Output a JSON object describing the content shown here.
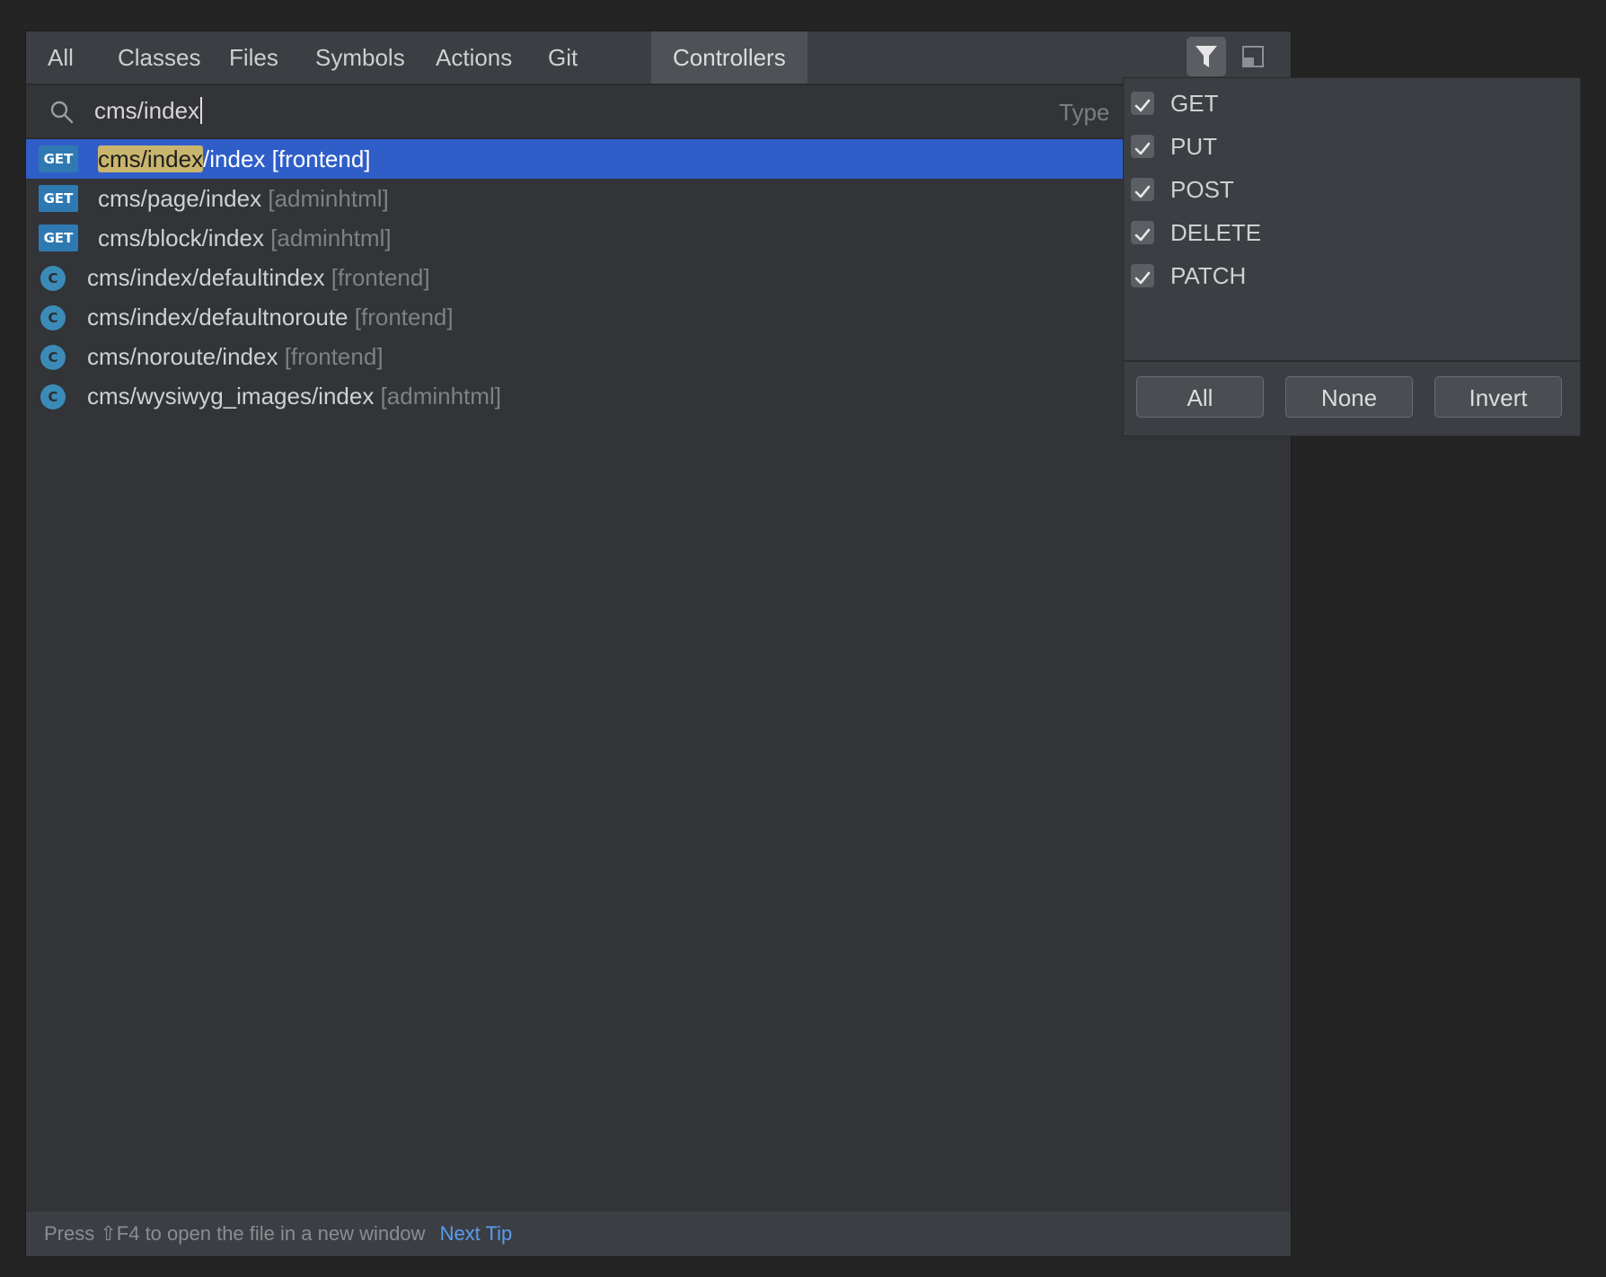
{
  "tabs": [
    {
      "label": "All",
      "active": false
    },
    {
      "label": "Classes",
      "active": false
    },
    {
      "label": "Files",
      "active": false
    },
    {
      "label": "Symbols",
      "active": false
    },
    {
      "label": "Actions",
      "active": false
    },
    {
      "label": "Git",
      "active": false
    },
    {
      "label": "Controllers",
      "active": true
    }
  ],
  "toolbar": {
    "filter_icon": "filter-icon",
    "preview_icon": "preview-panel-icon",
    "filter_active": true
  },
  "search": {
    "value": "cms/index",
    "hint": "Type "
  },
  "results": [
    {
      "kind": "GET",
      "match": "cms/index",
      "rest": "/index",
      "context": "[frontend]",
      "selected": true
    },
    {
      "kind": "GET",
      "match": "",
      "rest": "cms/page/index",
      "context": "[adminhtml]",
      "selected": false
    },
    {
      "kind": "GET",
      "match": "",
      "rest": "cms/block/index",
      "context": "[adminhtml]",
      "selected": false
    },
    {
      "kind": "C",
      "match": "",
      "rest": "cms/index/defaultindex",
      "context": "[frontend]",
      "selected": false
    },
    {
      "kind": "C",
      "match": "",
      "rest": "cms/index/defaultnoroute",
      "context": "[frontend]",
      "selected": false
    },
    {
      "kind": "C",
      "match": "",
      "rest": "cms/noroute/index",
      "context": "[frontend]",
      "selected": false
    },
    {
      "kind": "C",
      "match": "",
      "rest": "cms/wysiwyg_images/index",
      "context": "[adminhtml]",
      "selected": false
    }
  ],
  "filter": {
    "items": [
      {
        "label": "GET",
        "checked": true
      },
      {
        "label": "PUT",
        "checked": true
      },
      {
        "label": "POST",
        "checked": true
      },
      {
        "label": "DELETE",
        "checked": true
      },
      {
        "label": "PATCH",
        "checked": true
      }
    ],
    "buttons": {
      "all": "All",
      "none": "None",
      "invert": "Invert"
    }
  },
  "footer": {
    "tip": "Press ⇧F4 to open the file in a new window",
    "next_tip": "Next Tip"
  }
}
